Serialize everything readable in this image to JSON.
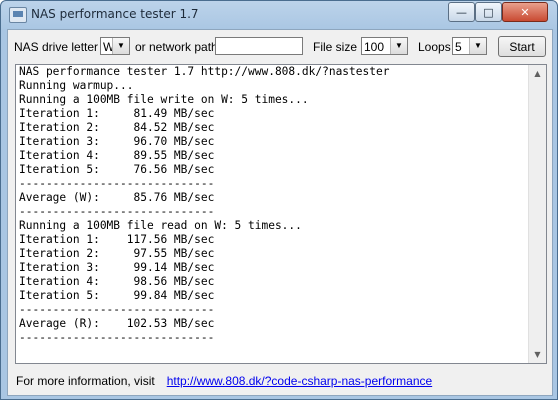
{
  "window": {
    "title": "NAS performance tester 1.7"
  },
  "caption_buttons": {
    "minimize": "—",
    "maximize": "□",
    "close": "✕"
  },
  "toolbar": {
    "drive_label": "NAS drive letter",
    "drive_value": "W",
    "network_label": "or network path",
    "network_value": "",
    "filesize_label": "File size",
    "filesize_value": "100",
    "loops_label": "Loops",
    "loops_value": "5",
    "start_label": "Start"
  },
  "log": {
    "lines": [
      "NAS performance tester 1.7 http://www.808.dk/?nastester",
      "Running warmup...",
      "Running a 100MB file write on W: 5 times...",
      "Iteration 1:     81.49 MB/sec",
      "Iteration 2:     84.52 MB/sec",
      "Iteration 3:     96.70 MB/sec",
      "Iteration 4:     89.55 MB/sec",
      "Iteration 5:     76.56 MB/sec",
      "-----------------------------",
      "Average (W):     85.76 MB/sec",
      "-----------------------------",
      "Running a 100MB file read on W: 5 times...",
      "Iteration 1:    117.56 MB/sec",
      "Iteration 2:     97.55 MB/sec",
      "Iteration 3:     99.14 MB/sec",
      "Iteration 4:     98.56 MB/sec",
      "Iteration 5:     99.84 MB/sec",
      "-----------------------------",
      "Average (R):    102.53 MB/sec",
      "-----------------------------"
    ]
  },
  "footer": {
    "text": "For more information, visit",
    "link": "http://www.808.dk/?code-csharp-nas-performance"
  },
  "icons": {
    "app": "app-icon",
    "dropdown": "chevron-down-icon",
    "scroll_up": "scroll-up-icon",
    "scroll_down": "scroll-down-icon"
  }
}
